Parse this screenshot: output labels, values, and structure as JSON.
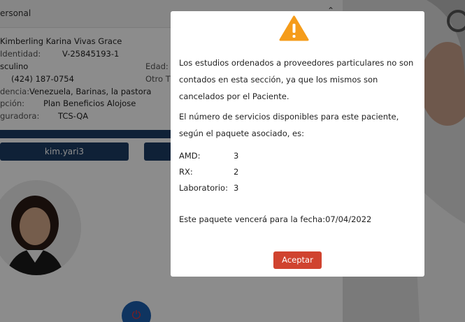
{
  "background": {
    "section_title": "ersonal",
    "fields": [
      {
        "label": "",
        "value": "Kimberling Karina Vivas Grace"
      },
      {
        "label": "Identidad:",
        "value": "V-25845193-1"
      },
      {
        "label": "sculino",
        "value": "",
        "extra_label": "Edad:"
      },
      {
        "label": "",
        "value": "(424) 187-0754",
        "extra_label": "Otro T"
      },
      {
        "label": "dencia:",
        "value": "Venezuela, Barinas, la pastora"
      },
      {
        "label": "pción:",
        "value": "Plan Beneficios Alojose"
      },
      {
        "label": "guradora:",
        "value": "TCS-QA"
      }
    ],
    "username_button": "kim.yari3"
  },
  "modal": {
    "colors": {
      "warning": "#f59c1a",
      "accept": "#d0432f"
    },
    "paragraph1": [
      "Los estudios ordenados a proveedores particulares no son",
      "contados en esta sección, ya que los mismos son",
      "cancelados por el Paciente."
    ],
    "paragraph2": [
      "El número de servicios disponibles para este paciente,",
      "según el paquete asociado, es:"
    ],
    "services": [
      {
        "name": "AMD:",
        "count": "3"
      },
      {
        "name": "RX:",
        "count": "2"
      },
      {
        "name": "Laboratorio:",
        "count": "3"
      }
    ],
    "expiry": "Este paquete vencerá para la fecha:07/04/2022",
    "accept_label": "Aceptar"
  }
}
